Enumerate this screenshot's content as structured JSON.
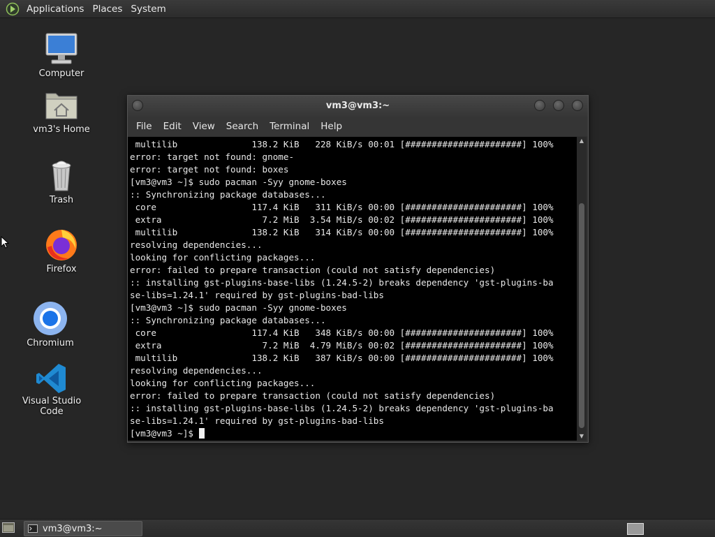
{
  "top_panel": {
    "menus": [
      "Applications",
      "Places",
      "System"
    ]
  },
  "desktop": {
    "icons": [
      {
        "label": "Computer",
        "icon": "computer-icon"
      },
      {
        "label": "vm3's Home",
        "icon": "home-folder-icon"
      },
      {
        "label": "Trash",
        "icon": "trash-icon"
      },
      {
        "label": "Firefox",
        "icon": "firefox-icon"
      },
      {
        "label": "Chromium",
        "icon": "chromium-icon"
      },
      {
        "label": "Visual Studio Code",
        "icon": "vscode-icon"
      }
    ]
  },
  "terminal": {
    "title": "vm3@vm3:~",
    "menus": [
      "File",
      "Edit",
      "View",
      "Search",
      "Terminal",
      "Help"
    ],
    "output": " multilib              138.2 KiB   228 KiB/s 00:01 [######################] 100%\nerror: target not found: gnome-\nerror: target not found: boxes\n[vm3@vm3 ~]$ sudo pacman -Syy gnome-boxes\n:: Synchronizing package databases...\n core                  117.4 KiB   311 KiB/s 00:00 [######################] 100%\n extra                   7.2 MiB  3.54 MiB/s 00:02 [######################] 100%\n multilib              138.2 KiB   314 KiB/s 00:00 [######################] 100%\nresolving dependencies...\nlooking for conflicting packages...\nerror: failed to prepare transaction (could not satisfy dependencies)\n:: installing gst-plugins-base-libs (1.24.5-2) breaks dependency 'gst-plugins-ba\nse-libs=1.24.1' required by gst-plugins-bad-libs\n[vm3@vm3 ~]$ sudo pacman -Syy gnome-boxes\n:: Synchronizing package databases...\n core                  117.4 KiB   348 KiB/s 00:00 [######################] 100%\n extra                   7.2 MiB  4.79 MiB/s 00:02 [######################] 100%\n multilib              138.2 KiB   387 KiB/s 00:00 [######################] 100%\nresolving dependencies...\nlooking for conflicting packages...\nerror: failed to prepare transaction (could not satisfy dependencies)\n:: installing gst-plugins-base-libs (1.24.5-2) breaks dependency 'gst-plugins-ba\nse-libs=1.24.1' required by gst-plugins-bad-libs",
    "prompt": "[vm3@vm3 ~]$ "
  },
  "taskbar": {
    "window_button": "vm3@vm3:~"
  }
}
